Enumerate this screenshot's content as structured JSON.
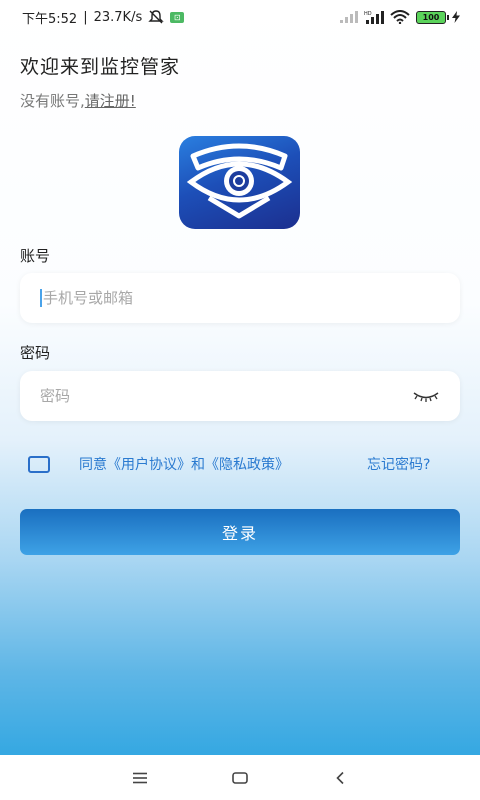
{
  "status_bar": {
    "time": "下午5:52",
    "network_speed": "23.7K/s",
    "badge_icon": "green-notification-icon",
    "icons": [
      "mute-icon",
      "hd-signal-icon",
      "wifi-icon",
      "battery-icon",
      "charging-icon"
    ],
    "battery": "100"
  },
  "header": {
    "welcome_title": "欢迎来到监控管家",
    "no_account_text": "没有账号,",
    "register_link": "请注册!"
  },
  "logo": {
    "icon": "eye-shield-logo",
    "colors": {
      "top": "#2a7fe0",
      "bottom": "#1b2f8f"
    }
  },
  "account": {
    "label": "账号",
    "placeholder": "手机号或邮箱",
    "value": ""
  },
  "password": {
    "label": "密码",
    "placeholder": "密码",
    "value": "",
    "toggle_icon": "eye-closed-icon"
  },
  "agreement": {
    "checked": false,
    "prefix": "同意",
    "user_agreement": "《用户协议》",
    "and": "和",
    "privacy_policy": "《隐私政策》"
  },
  "forgot_password": "忘记密码?",
  "login_button": "登录",
  "nav_bar": {
    "icons": [
      "menu-icon",
      "home-icon",
      "back-icon"
    ]
  },
  "colors": {
    "accent": "#2a7ad0",
    "button_top": "#1a6fc0",
    "button_bottom": "#3ea2e6"
  }
}
